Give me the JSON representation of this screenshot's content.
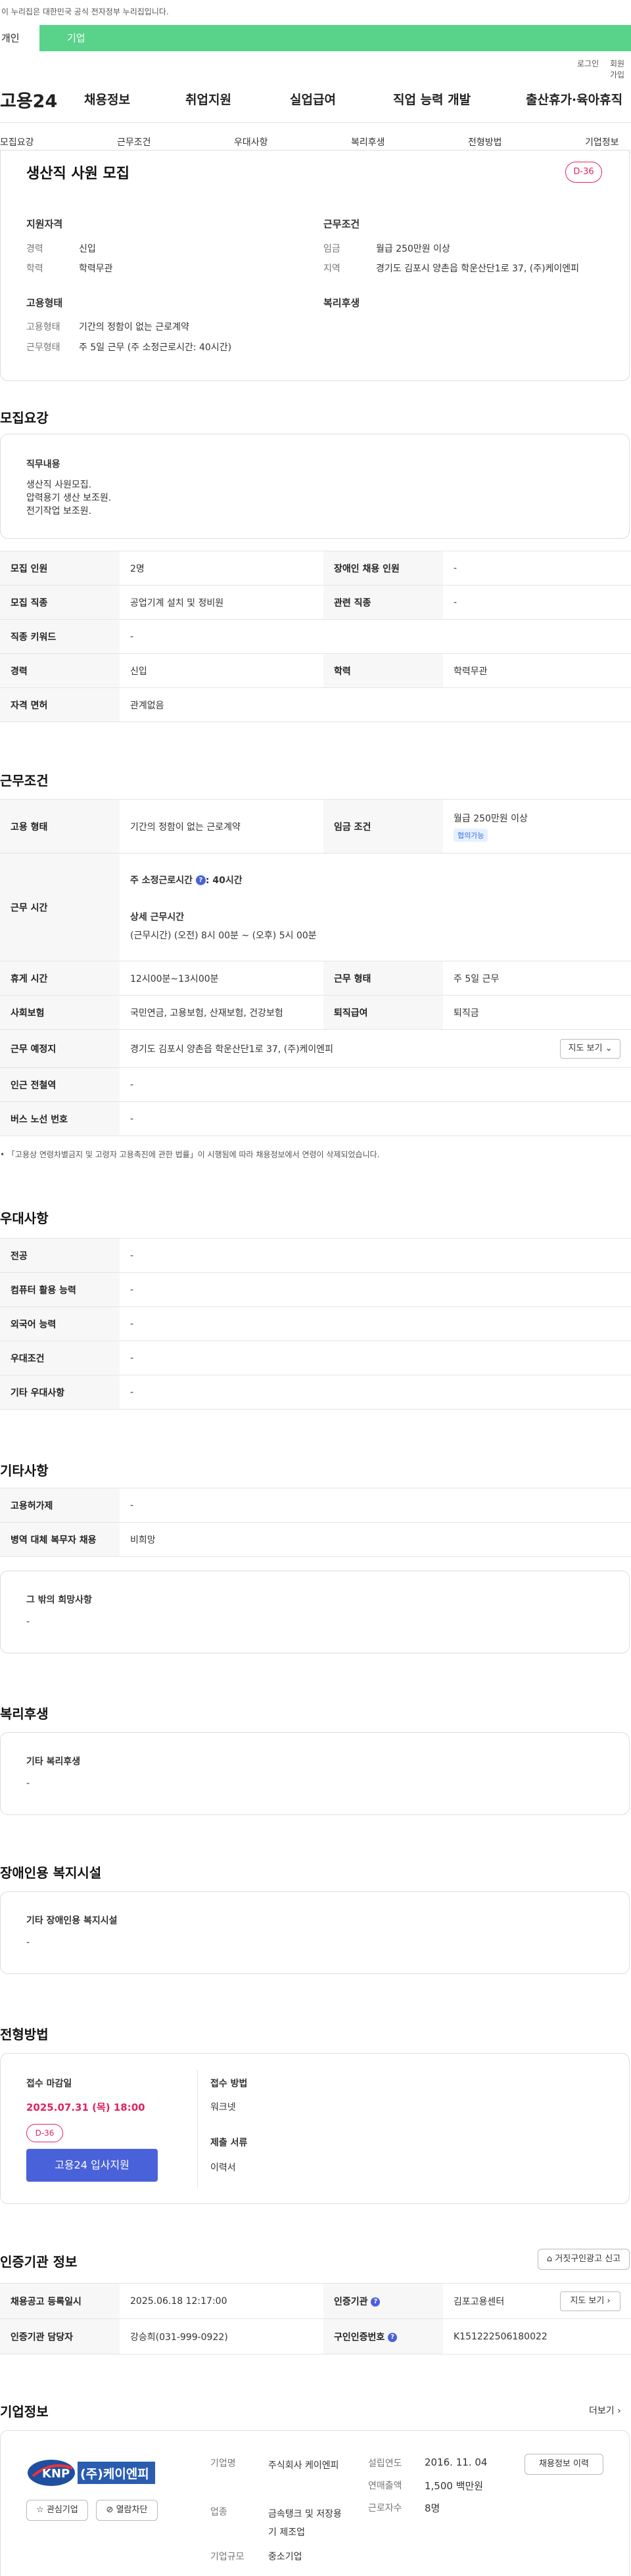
{
  "gov_banner": "이 누리집은 대한민국 공식 전자정부 누리집입니다.",
  "top_tabs": [
    "개인",
    "기업"
  ],
  "util": {
    "login": "로그인",
    "join": "회원가입"
  },
  "logo": "고용24",
  "gnb": [
    "채용정보",
    "취업지원",
    "실업급여",
    "직업 능력 개발",
    "출산휴가·육아휴직"
  ],
  "subnav": [
    "모집요강",
    "근무조건",
    "우대사항",
    "복리후생",
    "전형방법",
    "기업정보"
  ],
  "summary": {
    "title": "생산직 사원 모집",
    "dday": "D-36",
    "qual_title": "지원자격",
    "career_k": "경력",
    "career_v": "신입",
    "edu_k": "학력",
    "edu_v": "학력무관",
    "cond_title": "근무조건",
    "wage_k": "임금",
    "wage_v": "월급 250만원 이상",
    "loc_k": "지역",
    "loc_v": "경기도 김포시 양촌읍 학운산단1로 37, (주)케이엔피",
    "emp_title": "고용형태",
    "emptype_k": "고용형태",
    "emptype_v": "기간의 정함이 없는 근로계약",
    "worktime_k": "근무형태",
    "worktime_v": "주 5일 근무 (주 소정근로시간: 40시간)",
    "welfare_title": "복리후생"
  },
  "recruit": {
    "section": "모집요강",
    "duty_title": "직무내용",
    "duty_lines": [
      "생산직 사원모집.",
      "압력용기 생산 보조원.",
      "전기작업 보조원."
    ],
    "rows": [
      [
        "모집 인원",
        "2명",
        "장애인 채용 인원",
        "-"
      ],
      [
        "모집 직종",
        "공업기계 설치 및 정비원",
        "관련 직종",
        "-"
      ],
      [
        "직종 키워드",
        "-",
        "",
        ""
      ],
      [
        "경력",
        "신입",
        "학력",
        "학력무관"
      ],
      [
        "자격 면허",
        "관계없음",
        "",
        ""
      ]
    ]
  },
  "work": {
    "section": "근무조건",
    "type_k": "고용 형태",
    "type_v": "기간의 정함이 없는 근로계약",
    "wage_k": "임금 조건",
    "wage_v": "월급 250만원 이상",
    "wage_badge": "협의가능",
    "hours_k": "근무 시간",
    "hours_week": "주 소정근로시간",
    "hours_week_v": "40시간",
    "hours_detail_title": "상세 근무시간",
    "hours_detail": "(근무시간) (오전) 8시 00분 ~ (오후) 5시 00분",
    "rest_k": "휴게 시간",
    "rest_v": "12시00분~13시00분",
    "form_k": "근무 형태",
    "form_v": "주 5일 근무",
    "ins_k": "사회보험",
    "ins_v": "국민연금, 고용보험, 산재보험, 건강보험",
    "ret_k": "퇴직급여",
    "ret_v": "퇴직금",
    "place_k": "근무 예정지",
    "place_v": "경기도 김포시 양촌읍 학운산단1로 37, (주)케이엔피",
    "map_btn": "지도 보기",
    "subway_k": "인근 전철역",
    "subway_v": "-",
    "bus_k": "버스 노선 번호",
    "bus_v": "-",
    "note": "「고용상 연령차별금지 및 고령자 고용촉진에 관한 법률」이 시행됨에 따라 채용정보에서 연령이 삭제되었습니다."
  },
  "pref": {
    "section": "우대사항",
    "rows": [
      [
        "전공",
        "-"
      ],
      [
        "컴퓨터 활용 능력",
        "-"
      ],
      [
        "외국어 능력",
        "-"
      ],
      [
        "우대조건",
        "-"
      ],
      [
        "기타 우대사항",
        "-"
      ]
    ]
  },
  "etc": {
    "section": "기타사항",
    "rows": [
      [
        "고용허가제",
        "-"
      ],
      [
        "병역 대체 복무자 채용",
        "비희망"
      ]
    ],
    "hope_title": "그 밖의 희망사항",
    "hope_v": "-"
  },
  "welfare": {
    "section": "복리후생",
    "title": "기타 복리후생",
    "v": "-"
  },
  "disab": {
    "section": "장애인용 복지시설",
    "title": "기타 장애인용 복지시설",
    "v": "-"
  },
  "process": {
    "section": "전형방법",
    "deadline_title": "접수 마감일",
    "deadline": "2025.07.31 (목) 18:00",
    "dday": "D-36",
    "apply_btn": "고용24 입사지원",
    "method_title": "접수 방법",
    "method_v": "워크넷",
    "docs_title": "제출 서류",
    "docs_v": "이력서"
  },
  "cert": {
    "section": "인증기관 정보",
    "report_btn": "거짓구인광고 신고",
    "reg_k": "채용공고 등록일시",
    "reg_v": "2025.06.18 12:17:00",
    "org_k": "인증기관",
    "org_v": "김포고용센터",
    "org_btn": "지도 보기",
    "mgr_k": "인증기관 담당자",
    "mgr_v": "강승희(031-999-0922)",
    "num_k": "구인인증번호",
    "num_v": "K151222506180022"
  },
  "company": {
    "section": "기업정보",
    "more": "더보기",
    "logo_text": "(주)케이엔피",
    "fav_btn": "관심기업",
    "block_btn": "열람차단",
    "name_k": "기업명",
    "name_v": "주식회사 케이엔피",
    "ind_k": "업종",
    "ind_v": "금속탱크 및 저장용기 제조업",
    "size_k": "기업규모",
    "size_v": "중소기업",
    "est_k": "설립연도",
    "est_v": "2016. 11. 04",
    "sales_k": "연매출액",
    "sales_v": "1,500 백만원",
    "emp_k": "근로자수",
    "emp_v": "8명",
    "jobs_btn": "채용정보 이력"
  }
}
